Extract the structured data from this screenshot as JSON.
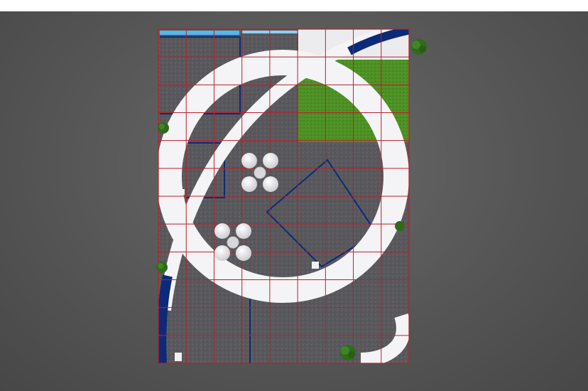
{
  "scene": {
    "type": "exhibition-booth-floor-plan-render",
    "colors": {
      "background": "#565656",
      "floor": "#5a5a5e",
      "grid": "#b8202a",
      "ring": "#f4f4f6",
      "navy": "#0d2a78",
      "grass": "#4c8f24",
      "plant": "#2f6b1a"
    },
    "grid": {
      "columns": 9,
      "rows": 12
    },
    "icons": [
      "plant-icon",
      "table-chairs-icon",
      "sign-plate-icon"
    ]
  }
}
